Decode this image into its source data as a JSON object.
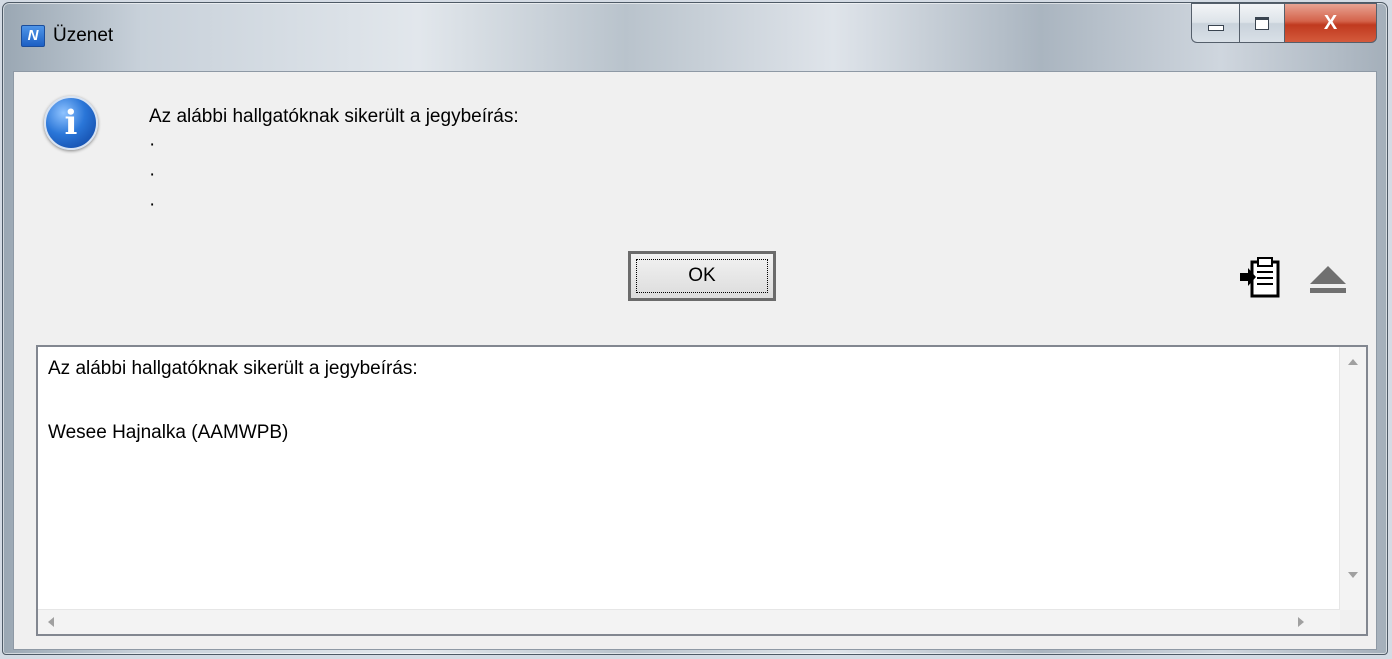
{
  "window": {
    "title": "Üzenet",
    "app_icon_glyph": "N",
    "close_glyph": "X"
  },
  "dialog": {
    "message": "Az alábbi hallgatóknak sikerült a jegybeírás:",
    "dots": [
      "·",
      "·",
      "·"
    ],
    "ok_label": "OK",
    "icon": "info-icon"
  },
  "details": {
    "lines": [
      "Az alábbi hallgatóknak sikerült a jegybeírás:",
      "",
      "Wesee Hajnalka (AAMWPB)"
    ]
  },
  "colors": {
    "accent": "#2a76d8",
    "close_button": "#c03a1f"
  }
}
